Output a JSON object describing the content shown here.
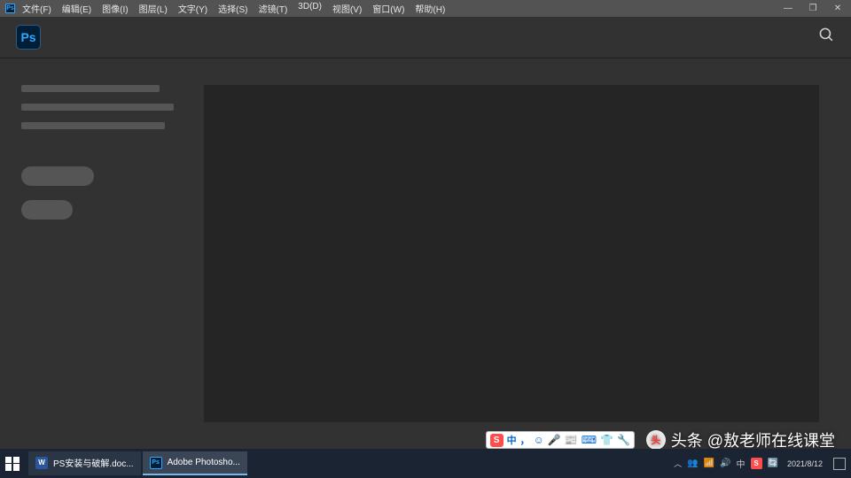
{
  "menubar": {
    "items": [
      "文件(F)",
      "编辑(E)",
      "图像(I)",
      "图层(L)",
      "文字(Y)",
      "选择(S)",
      "滤镜(T)",
      "3D(D)",
      "视图(V)",
      "窗口(W)",
      "帮助(H)"
    ]
  },
  "window_controls": {
    "min": "―",
    "max": "❐",
    "close": "✕"
  },
  "logo": "Ps",
  "ime": {
    "badge": "S",
    "lang": "中",
    "icons": [
      "☺",
      "🎤",
      "📰",
      "⌨",
      "👕",
      "🔧"
    ]
  },
  "watermark": {
    "prefix": "头条 @",
    "text": "敖老师在线课堂"
  },
  "taskbar": {
    "items": [
      {
        "icon": "W",
        "label": "PS安装与破解.doc...",
        "cls": "ti-word",
        "active": false
      },
      {
        "icon": "Ps",
        "label": "Adobe Photosho...",
        "cls": "ti-ps",
        "active": true
      }
    ]
  },
  "tray": {
    "lang": "中",
    "time": "",
    "date": "2021/8/12"
  }
}
